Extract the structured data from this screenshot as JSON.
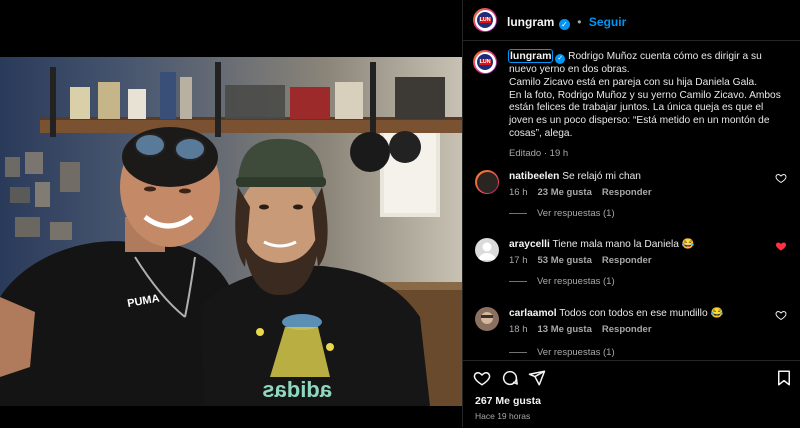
{
  "post": {
    "username": "lungram",
    "follow_label": "Seguir",
    "caption_lines": [
      "Rodrigo Muñoz cuenta cómo es dirigir a su nuevo yerno en dos obras.",
      "Camilo Zicavo está en pareja con su hija Daniela Gala.",
      "En la foto, Rodrigo Muñoz y su yerno Camilo Zicavo. Ambos están felices de trabajar juntos. La única queja es que el joven es un poco disperso: “Está metido en un montón de cosas”, alega."
    ],
    "caption_meta": "Editado · 19 h",
    "avatar_logo": "LUN"
  },
  "comments": [
    {
      "user": "natibeelen",
      "text": "Se relajó mi chan",
      "time": "16 h",
      "likes": "23 Me gusta",
      "reply": "Responder",
      "view_replies": "Ver respuestas (1)",
      "liked": false
    },
    {
      "user": "araycelli",
      "text": "Tiene mala mano la Daniela 😂",
      "time": "17 h",
      "likes": "53 Me gusta",
      "reply": "Responder",
      "view_replies": "Ver respuestas (1)",
      "liked": true
    },
    {
      "user": "carlaamol",
      "text": "Todos con todos en ese mundillo 😂",
      "time": "18 h",
      "likes": "13 Me gusta",
      "reply": "Responder",
      "view_replies": "Ver respuestas (1)",
      "liked": false
    }
  ],
  "footer": {
    "likes": "267 Me gusta",
    "time": "Hace 19 horas"
  },
  "photo": {
    "shirt_text": "adidas",
    "shirt_brand": "PUMA"
  },
  "colors": {
    "accent": "#0095f6",
    "liked_heart": "#ff3040"
  }
}
